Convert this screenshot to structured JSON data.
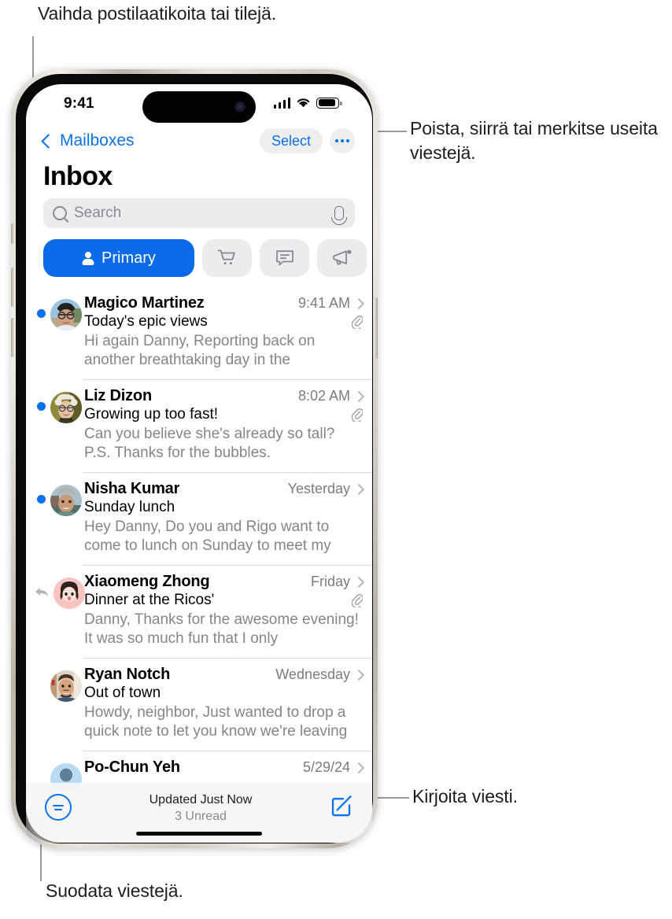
{
  "callouts": {
    "mailboxes": "Vaihda postilaatikoita tai tilejä.",
    "select": "Poista, siirrä tai merkitse useita viestejä.",
    "compose": "Kirjoita viesti.",
    "filter": "Suodata viestejä."
  },
  "status_bar": {
    "time": "9:41",
    "cellular_icon": "signal-bars-icon",
    "wifi_icon": "wifi-icon",
    "battery_icon": "battery-icon"
  },
  "nav": {
    "back_label": "Mailboxes",
    "back_icon": "chevron-left-icon",
    "select_label": "Select",
    "more_icon": "ellipsis-icon"
  },
  "page_title": "Inbox",
  "search": {
    "placeholder": "Search",
    "search_icon": "search-icon",
    "dictate_icon": "microphone-icon"
  },
  "tabs": [
    {
      "label": "Primary",
      "icon": "person-icon",
      "selected": true
    },
    {
      "label": "",
      "icon": "shopping-cart-icon",
      "selected": false
    },
    {
      "label": "",
      "icon": "speech-bubble-icon",
      "selected": false
    },
    {
      "label": "",
      "icon": "megaphone-icon",
      "selected": false
    }
  ],
  "messages": [
    {
      "sender": "Magico Martinez",
      "time": "9:41 AM",
      "subject": "Today's epic views",
      "preview": "Hi again Danny, Reporting back on another breathtaking day in the mountains. Wide o…",
      "unread": true,
      "replied": false,
      "attachment": true,
      "avatar_colors": [
        "#8fbfe0",
        "#4c3a2e",
        "#d9c9a8"
      ]
    },
    {
      "sender": "Liz Dizon",
      "time": "8:02 AM",
      "subject": "Growing up too fast!",
      "preview": "Can you believe she's already so tall? P.S. Thanks for the bubbles.",
      "unread": true,
      "replied": false,
      "attachment": true,
      "avatar_colors": [
        "#8d8a3d",
        "#e8e3d6",
        "#3c3a20"
      ]
    },
    {
      "sender": "Nisha Kumar",
      "time": "Yesterday",
      "subject": "Sunday lunch",
      "preview": "Hey Danny, Do you and Rigo want to come to lunch on Sunday to meet my dad? If you…",
      "unread": true,
      "replied": false,
      "attachment": false,
      "avatar_colors": [
        "#9db5c4",
        "#7d6a5a",
        "#53706a"
      ]
    },
    {
      "sender": "Xiaomeng Zhong",
      "time": "Friday",
      "subject": "Dinner at the Ricos'",
      "preview": "Danny, Thanks for the awesome evening! It was so much fun that I only remembered t…",
      "unread": false,
      "replied": true,
      "attachment": true,
      "avatar_colors": [
        "#f9c4c0",
        "#3a2a26",
        "#ffffff"
      ]
    },
    {
      "sender": "Ryan Notch",
      "time": "Wednesday",
      "subject": "Out of town",
      "preview": "Howdy, neighbor, Just wanted to drop a quick note to let you know we're leaving T…",
      "unread": false,
      "replied": false,
      "attachment": false,
      "avatar_colors": [
        "#e4d6c4",
        "#6b4a33",
        "#3e5a78"
      ]
    },
    {
      "sender": "Po-Chun Yeh",
      "time": "5/29/24",
      "subject": "",
      "preview": "",
      "unread": false,
      "replied": false,
      "attachment": false,
      "avatar_colors": [
        "#b9dcf2",
        "#6d8ea3",
        "#d9eef8"
      ]
    }
  ],
  "toolbar": {
    "filter_icon": "filter-icon",
    "updated_text": "Updated Just Now",
    "unread_text": "3 Unread",
    "compose_icon": "compose-icon"
  },
  "colors": {
    "accent": "#0a72ee",
    "primary_tab": "#0a6ae8",
    "chip_bg": "#ececee",
    "secondary_text": "#85858a"
  }
}
